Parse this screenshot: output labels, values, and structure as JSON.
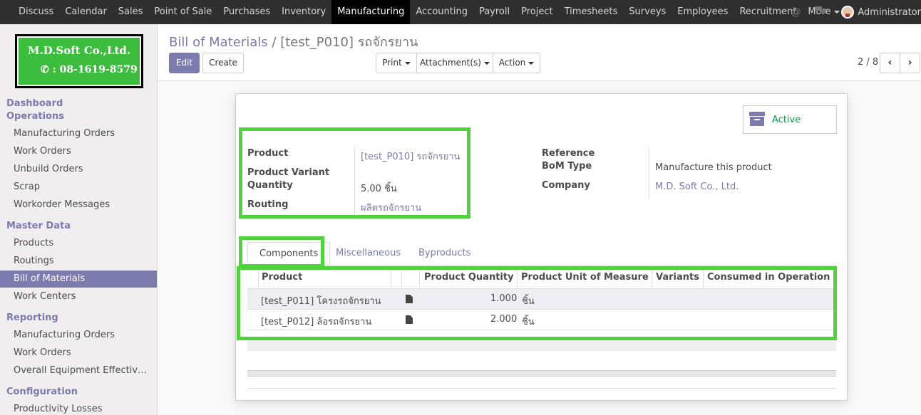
{
  "topbar": {
    "menu": [
      "Discuss",
      "Calendar",
      "Sales",
      "Point of Sale",
      "Purchases",
      "Inventory",
      "Manufacturing",
      "Accounting",
      "Payroll",
      "Project",
      "Timesheets",
      "Surveys",
      "Employees",
      "Recruitment",
      "More"
    ],
    "active": "Manufacturing",
    "user": "Administrator"
  },
  "logo": {
    "company": "M.D.Soft Co.,Ltd.",
    "phone": ": 08-1619-8579"
  },
  "sidebar": {
    "dashboard": "Dashboard",
    "operations": {
      "title": "Operations",
      "items": [
        "Manufacturing Orders",
        "Work Orders",
        "Unbuild Orders",
        "Scrap",
        "Workorder Messages"
      ]
    },
    "master": {
      "title": "Master Data",
      "items": [
        "Products",
        "Routings",
        "Bill of Materials",
        "Work Centers"
      ]
    },
    "reporting": {
      "title": "Reporting",
      "items": [
        "Manufacturing Orders",
        "Work Orders",
        "Overall Equipment Effectiv…"
      ]
    },
    "configuration": {
      "title": "Configuration",
      "items": [
        "Productivity Losses"
      ]
    }
  },
  "breadcrumb": {
    "parent": "Bill of Materials",
    "sep": "/",
    "current": "[test_P010] รถจักรยาน"
  },
  "buttons": {
    "edit": "Edit",
    "create": "Create",
    "print": "Print",
    "attachments": "Attachment(s)",
    "action": "Action"
  },
  "pager": {
    "value": "2 / 8",
    "prev": "‹",
    "next": "›"
  },
  "status": {
    "label": "Active"
  },
  "form": {
    "product_label": "Product",
    "product_value": "[test_P010] รถจักรยาน",
    "variant_label": "Product Variant",
    "quantity_label": "Quantity",
    "quantity_value": "5.00 ชิ้น",
    "routing_label": "Routing",
    "routing_value": "ผลิตรถจักรยาน",
    "reference_label": "Reference",
    "bomtype_label": "BoM Type",
    "bomtype_value": "Manufacture this product",
    "company_label": "Company",
    "company_value": "M.D. Soft Co., Ltd."
  },
  "tabs": [
    "Components",
    "Miscellaneous",
    "Byproducts"
  ],
  "table": {
    "headers": [
      "Product",
      "Product Quantity",
      "Product Unit of Measure",
      "Variants",
      "Consumed in Operation"
    ],
    "rows": [
      {
        "product": "[test_P011] โครงรถจักรยาน",
        "qty": "1.000",
        "uom": "ชิ้น"
      },
      {
        "product": "[test_P012] ล้อรถจักรยาน",
        "qty": "2.000",
        "uom": "ชิ้น"
      }
    ]
  },
  "colors": {
    "accent": "#7c7bad",
    "highlight": "#4ed33a",
    "active_status": "#00a04a",
    "topbar": "#2f2f2f"
  }
}
